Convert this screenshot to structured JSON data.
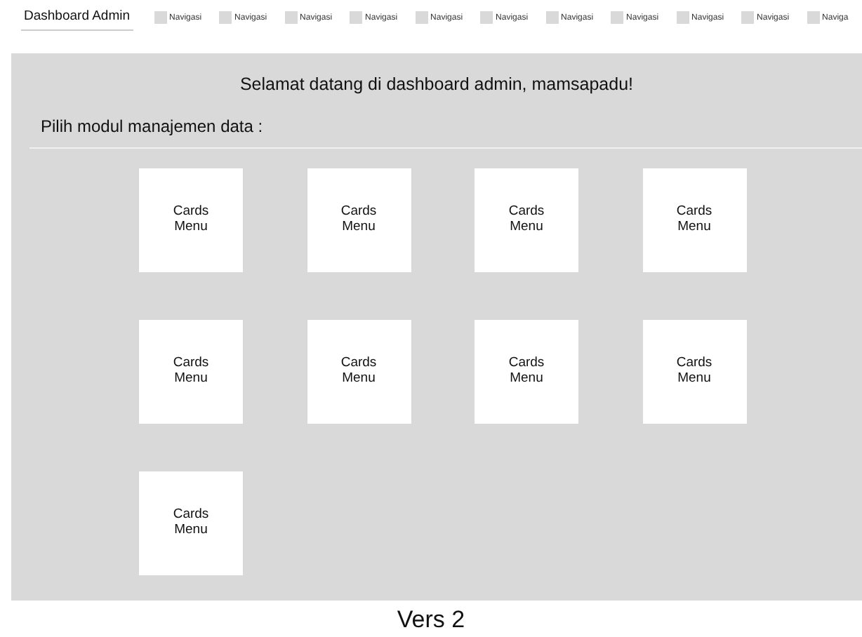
{
  "header": {
    "title": "Dashboard Admin",
    "nav": [
      {
        "label": "Navigasi"
      },
      {
        "label": "Navigasi"
      },
      {
        "label": "Navigasi"
      },
      {
        "label": "Navigasi"
      },
      {
        "label": "Navigasi"
      },
      {
        "label": "Navigasi"
      },
      {
        "label": "Navigasi"
      },
      {
        "label": "Navigasi"
      },
      {
        "label": "Navigasi"
      },
      {
        "label": "Navigasi"
      },
      {
        "label": "Naviga"
      }
    ]
  },
  "main": {
    "welcome": "Selamat datang di dashboard admin, mamsapadu!",
    "prompt": "Pilih modul manajemen data :",
    "cards": [
      {
        "label": "Cards Menu"
      },
      {
        "label": "Cards Menu"
      },
      {
        "label": "Cards Menu"
      },
      {
        "label": "Cards Menu"
      },
      {
        "label": "Cards Menu"
      },
      {
        "label": "Cards Menu"
      },
      {
        "label": "Cards Menu"
      },
      {
        "label": "Cards Menu"
      },
      {
        "label": "Cards Menu"
      }
    ]
  },
  "footer": {
    "version": "Vers 2"
  }
}
